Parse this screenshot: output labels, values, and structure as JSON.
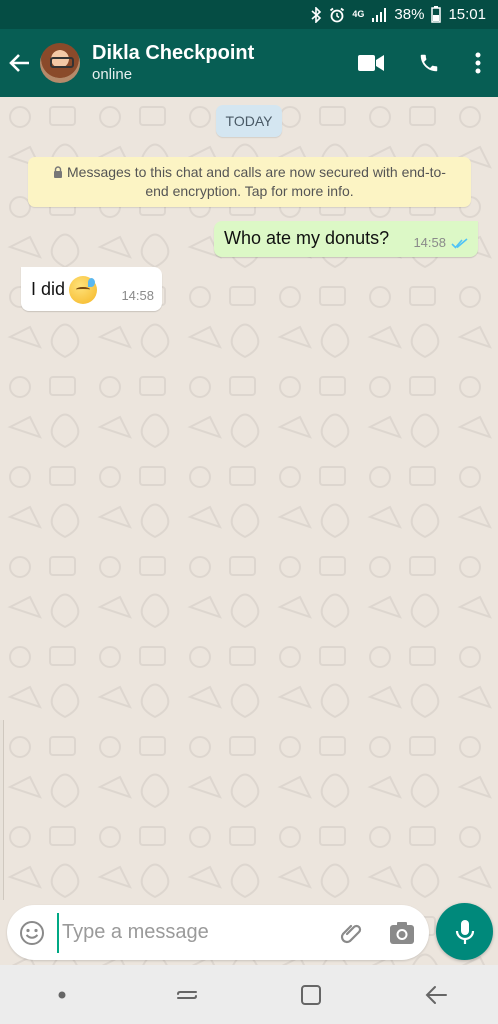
{
  "status_bar": {
    "network": "4G",
    "battery": "38%",
    "time": "15:01"
  },
  "header": {
    "contact_name": "Dikla Checkpoint",
    "contact_status": "online"
  },
  "chat": {
    "date_chip": "TODAY",
    "encryption_note": "Messages to this chat and calls are now secured with end-to-end encryption. Tap for more info.",
    "messages": [
      {
        "direction": "outgoing",
        "text": "Who ate my donuts?",
        "time": "14:58",
        "status": "read"
      },
      {
        "direction": "incoming",
        "text": "I did",
        "time": "14:58",
        "emoji": "downcast-face-with-sweat"
      }
    ]
  },
  "composer": {
    "placeholder": "Type a message"
  },
  "colors": {
    "header": "#075e54",
    "status_bar": "#054d44",
    "outgoing_bubble": "#dcf8c6",
    "incoming_bubble": "#ffffff",
    "chat_background": "#ece5dd",
    "mic_button": "#00897b",
    "read_ticks": "#4fc3f7"
  },
  "icons": {
    "back": "arrow-left-icon",
    "video": "video-camera-icon",
    "call": "phone-icon",
    "menu": "more-vertical-icon",
    "emoji": "smiley-icon",
    "attach": "paperclip-icon",
    "camera": "camera-icon",
    "mic": "microphone-icon"
  }
}
